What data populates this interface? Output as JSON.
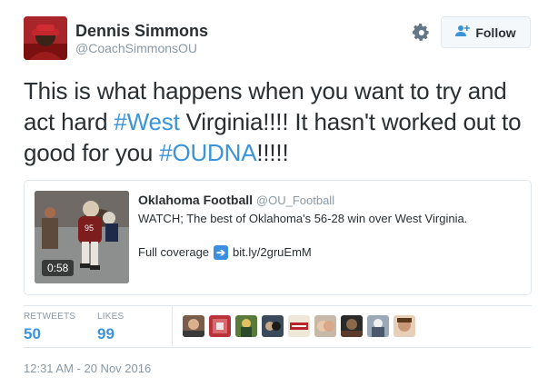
{
  "user": {
    "display_name": "Dennis Simmons",
    "handle": "@CoachSimmonsOU"
  },
  "actions": {
    "follow_label": "Follow"
  },
  "tweet": {
    "text_1": "This is what happens when you want to try and act hard ",
    "hashtag_1": "#West",
    "text_2": " Virginia!!!! It hasn't worked out to good for you ",
    "hashtag_2": "#OUDNA",
    "text_3": "!!!!!"
  },
  "card": {
    "author_name": "Oklahoma Football",
    "author_handle": "@OU_Football",
    "line_1": "WATCH; The best of Oklahoma's 56-28 win over West Virginia.",
    "line_2_prefix": "Full coverage",
    "link": "bit.ly/2gruEmM",
    "video_duration": "0:58"
  },
  "stats": {
    "retweets_label": "RETWEETS",
    "retweets_value": "50",
    "likes_label": "LIKES",
    "likes_value": "99"
  },
  "timestamp": "12:31 AM - 20 Nov 2016",
  "colors": {
    "accent": "#3b94d9",
    "text": "#292f33",
    "muted": "#8899a6",
    "border": "#e1e8ed"
  }
}
